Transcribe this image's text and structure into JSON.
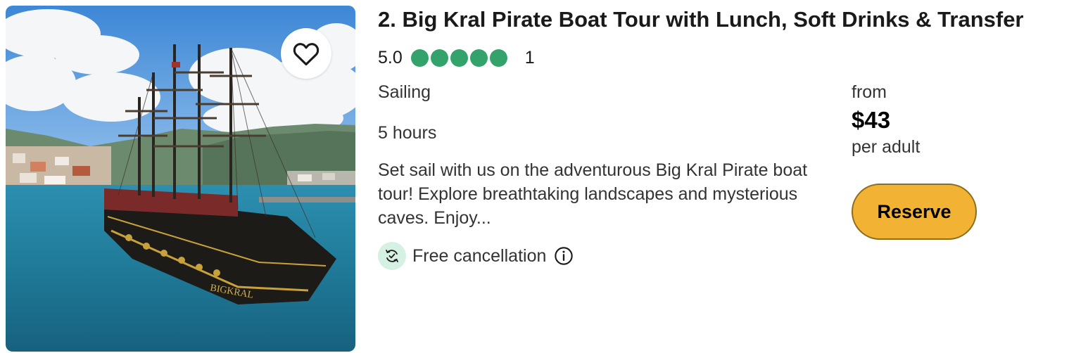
{
  "listing": {
    "title": "2. Big Kral Pirate Boat Tour with Lunch, Soft Drinks & Transfer",
    "rating_value": "5.0",
    "rating_bubbles": 5,
    "review_count": "1",
    "category": "Sailing",
    "duration": "5 hours",
    "description": "Set sail with us on the adventurous Big Kral Pirate boat tour! Explore breathtaking landscapes and mysterious caves. Enjoy...",
    "cancellation": "Free cancellation",
    "ship_name": "BIGKRAL"
  },
  "pricing": {
    "from_label": "from",
    "price": "$43",
    "per_label": "per adult",
    "reserve_label": "Reserve"
  },
  "colors": {
    "rating_green": "#34a36b",
    "reserve_yellow": "#f2b233",
    "cancel_icon_bg": "#d4f1e4"
  },
  "icons": {
    "favorite": "heart-icon",
    "cancellation": "refresh-check-icon",
    "info": "info-icon"
  }
}
